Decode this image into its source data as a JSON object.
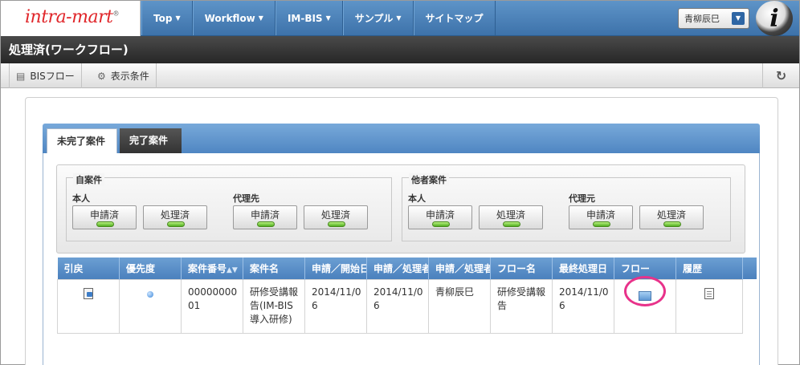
{
  "nav": {
    "logo_main": "intra-mart",
    "items": [
      {
        "label": "Top",
        "has_caret": true
      },
      {
        "label": "Workflow",
        "has_caret": true
      },
      {
        "label": "IM-BIS",
        "has_caret": true
      },
      {
        "label": "サンプル",
        "has_caret": true
      },
      {
        "label": "サイトマップ",
        "has_caret": false
      }
    ],
    "user_name": "青柳辰巳"
  },
  "page_title": "処理済(ワークフロー)",
  "toolbar": {
    "bis_flow": "BISフロー",
    "display_conditions": "表示条件"
  },
  "tabs": {
    "active": "未完了案件",
    "inactive": "完了案件"
  },
  "summary": {
    "own": {
      "legend": "自案件",
      "groups": [
        {
          "label": "本人",
          "buttons": [
            "申請済",
            "処理済"
          ]
        },
        {
          "label": "代理先",
          "buttons": [
            "申請済",
            "処理済"
          ]
        }
      ]
    },
    "others": {
      "legend": "他者案件",
      "groups": [
        {
          "label": "本人",
          "buttons": [
            "申請済",
            "処理済"
          ]
        },
        {
          "label": "代理元",
          "buttons": [
            "申請済",
            "処理済"
          ]
        }
      ]
    }
  },
  "table": {
    "headers": [
      "引戻",
      "優先度",
      "案件番号",
      "案件名",
      "申請／開始日",
      "申請／処理者",
      "申請／処理者",
      "フロー名",
      "最終処理日",
      "フロー",
      "履歴"
    ],
    "rows": [
      {
        "case_number": "0000000001",
        "case_name": "研修受講報告(IM-BIS導入研修)",
        "apply_date": "2014/11/06",
        "process_date": "2014/11/06",
        "processor": "青柳辰巳",
        "flow_name": "研修受講報告",
        "last_processed": "2014/11/06"
      }
    ]
  },
  "colors": {
    "nav_blue": "#4a80bd",
    "title_dark": "#2e2e2e",
    "highlight": "#e8328a",
    "lamp_green": "#52b020"
  }
}
